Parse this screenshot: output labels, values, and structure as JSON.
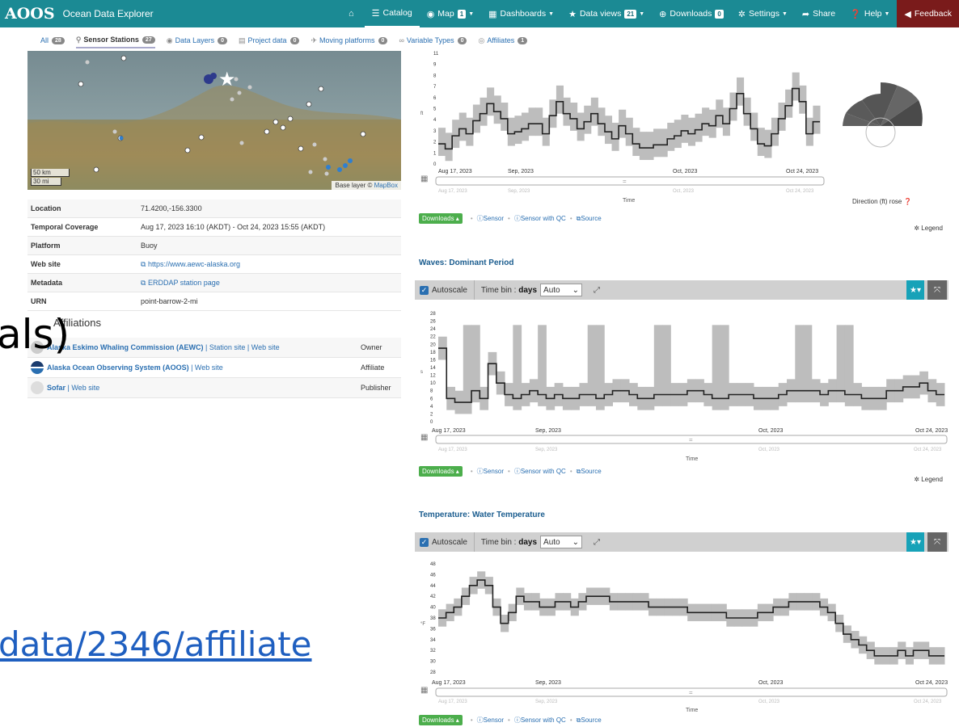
{
  "navbar": {
    "logo": "AOOS",
    "title": "Ocean Data Explorer",
    "items": [
      {
        "label": "",
        "icon": "home-icon"
      },
      {
        "label": "Catalog",
        "icon": "list-icon"
      },
      {
        "label": "Map",
        "icon": "globe-icon",
        "badge": "1"
      },
      {
        "label": "Dashboards",
        "icon": "grid-icon"
      },
      {
        "label": "Data views",
        "icon": "star-icon",
        "badge": "21"
      },
      {
        "label": "Downloads",
        "icon": "download-icon",
        "badge": "0"
      },
      {
        "label": "Settings",
        "icon": "gear-icon"
      },
      {
        "label": "Share",
        "icon": "share-icon"
      },
      {
        "label": "Help",
        "icon": "help-icon"
      },
      {
        "label": "Feedback",
        "icon": "megaphone-icon"
      }
    ]
  },
  "subtabs": [
    {
      "label": "All",
      "count": "28"
    },
    {
      "label": "Sensor Stations",
      "count": "27"
    },
    {
      "label": "Data Layers",
      "count": "0"
    },
    {
      "label": "Project data",
      "count": "0"
    },
    {
      "label": "Moving platforms",
      "count": "0"
    },
    {
      "label": "Variable Types",
      "count": "0"
    },
    {
      "label": "Affiliates",
      "count": "1"
    }
  ],
  "map": {
    "scale_km": "50 km",
    "scale_mi": "30 mi",
    "attribution": "Base layer ©",
    "attribution_link": "MapBox"
  },
  "station": {
    "rows": [
      {
        "key": "Location",
        "value": "71.4200,-156.3300",
        "link": false
      },
      {
        "key": "Temporal Coverage",
        "value": "Aug 17, 2023 16:10 (AKDT) - Oct 24, 2023 15:55 (AKDT)",
        "link": false
      },
      {
        "key": "Platform",
        "value": "Buoy",
        "link": false
      },
      {
        "key": "Web site",
        "value": "https://www.aewc-alaska.org",
        "link": true
      },
      {
        "key": "Metadata",
        "value": "ERDDAP station page",
        "link": true
      },
      {
        "key": "URN",
        "value": "point-barrow-2-mi",
        "link": false
      }
    ]
  },
  "affiliations": {
    "heading": "Affiliations",
    "rows": [
      {
        "name": "Alaska Eskimo Whaling Commission (AEWC)",
        "extra": " | Station site | Web site",
        "role": "Owner"
      },
      {
        "name": "Alaska Ocean Observing System (AOOS)",
        "extra": " | Web site",
        "role": "Affiliate"
      },
      {
        "name": "Sofar",
        "extra": " | Web site",
        "role": "Publisher"
      }
    ]
  },
  "overlay": {
    "text_a": "als)",
    "text_b": "data/2346/affiliate"
  },
  "charts": {
    "wave_height": {
      "ylabel": "ft",
      "ticks": [
        "11",
        "9",
        "8",
        "7",
        "6",
        "5",
        "4",
        "3",
        "2",
        "1",
        "0"
      ],
      "x_labels": [
        "Aug 17, 2023",
        "Sep, 2023",
        "Oct, 2023",
        "Oct 24, 2023"
      ],
      "nav_labels": [
        "Aug 17, 2023",
        "Sep, 2023",
        "Oct, 2023",
        "Oct 24, 2023"
      ],
      "xlabel": "Time",
      "rose_caption": "Direction (ft) rose"
    },
    "period": {
      "title": "Waves: Dominant Period",
      "ylabel": "s",
      "ticks": [
        "28",
        "26",
        "24",
        "22",
        "20",
        "18",
        "16",
        "14",
        "12",
        "10",
        "8",
        "6",
        "4",
        "2",
        "0"
      ],
      "x_labels": [
        "Aug 17, 2023",
        "Sep, 2023",
        "Oct, 2023",
        "Oct 24, 2023"
      ],
      "nav_labels": [
        "Aug 17, 2023",
        "Sep, 2023",
        "Oct, 2023",
        "Oct 24, 2023"
      ],
      "xlabel": "Time"
    },
    "temp": {
      "title": "Temperature: Water Temperature",
      "ylabel": "°F",
      "ticks": [
        "48",
        "46",
        "44",
        "42",
        "40",
        "38",
        "36",
        "34",
        "32",
        "30",
        "28"
      ],
      "x_labels": [
        "Aug 17, 2023",
        "Sep, 2023",
        "Oct, 2023",
        "Oct 24, 2023"
      ],
      "nav_labels": [
        "Aug 17, 2023",
        "Sep, 2023",
        "Oct, 2023",
        "Oct 24, 2023"
      ],
      "xlabel": "Time"
    }
  },
  "toolbar": {
    "autoscale": "Autoscale",
    "timebin_prefix": "Time bin :",
    "timebin_value": "days",
    "select_value": "Auto"
  },
  "links": {
    "downloads": "Downloads",
    "sensor": "Sensor",
    "sensor_qc": "Sensor with QC",
    "source": "Source",
    "legend": "Legend"
  },
  "colors": {
    "navbar": "#1b8a94",
    "feedback": "#7a1b1b",
    "link": "#2a6fb1",
    "line": "#222222",
    "band": "#bdbdbd",
    "downloads": "#4cae4c"
  }
}
